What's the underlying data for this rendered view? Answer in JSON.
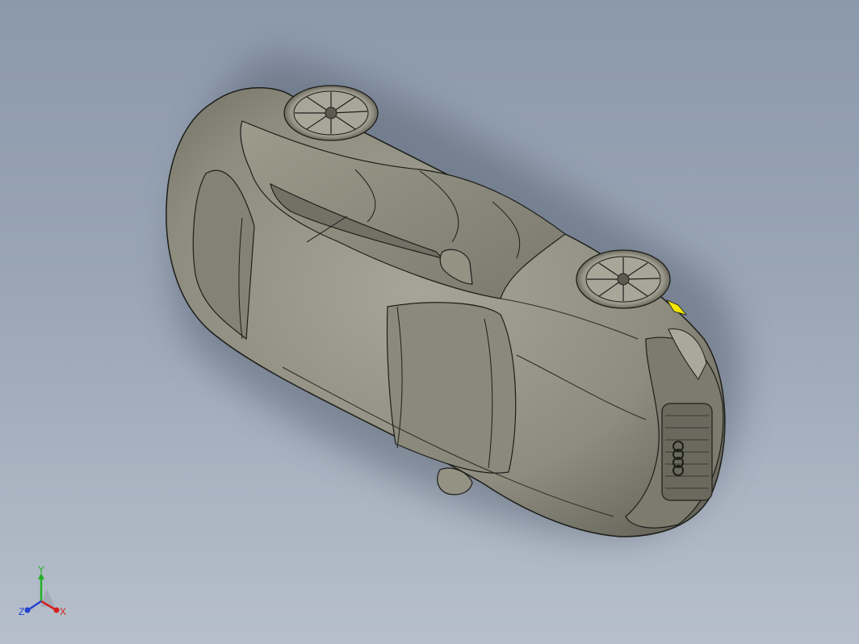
{
  "viewport": {
    "background_top": "#8c99ab",
    "background_bottom": "#b6bfcb",
    "model_color": "#8f8e80",
    "edge_color": "#1e1e1a",
    "highlight_color": "#f2e600"
  },
  "triad": {
    "x_label": "X",
    "y_label": "Y",
    "z_label": "Z",
    "x_color": "#d52020",
    "y_color": "#22b022",
    "z_color": "#2040d0"
  }
}
